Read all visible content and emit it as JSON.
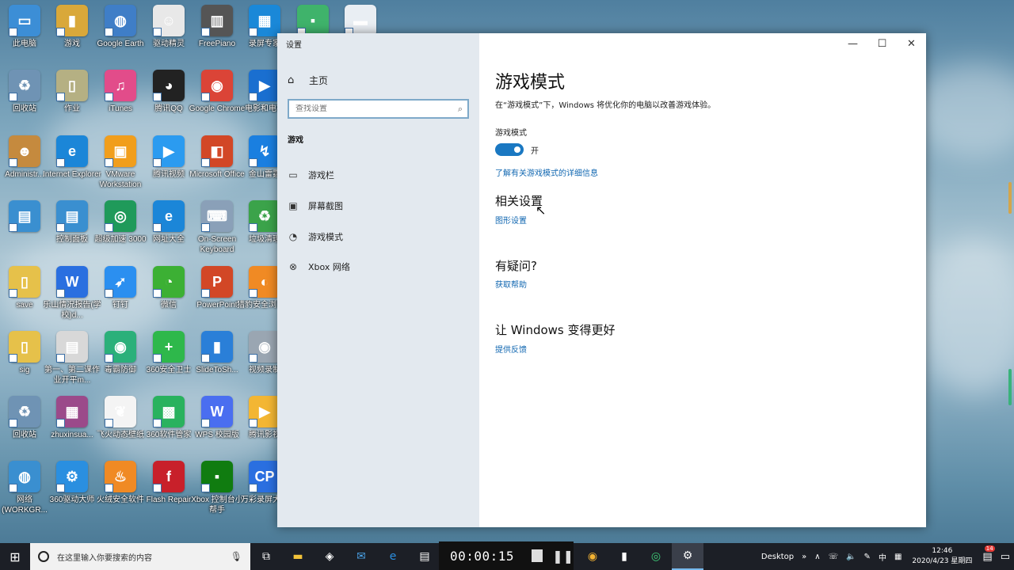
{
  "desktop": {
    "icons": [
      {
        "label": "此电脑",
        "color": "#3c8ed6",
        "glyph": "▭"
      },
      {
        "label": "游戏",
        "color": "#d9a83a",
        "glyph": "▮"
      },
      {
        "label": "Google Earth",
        "color": "#3f7ec7",
        "glyph": "◍"
      },
      {
        "label": "驱动精灵",
        "color": "#e8e8e8",
        "glyph": "☺"
      },
      {
        "label": "FreePiano",
        "color": "#555555",
        "glyph": "▥"
      },
      {
        "label": "录屏专家",
        "color": "#1a88d8",
        "glyph": "▦"
      },
      {
        "label": "",
        "color": "#3fb36b",
        "glyph": "▪"
      },
      {
        "label": "",
        "color": "#e9eef3",
        "glyph": "▬"
      },
      {
        "label": "回收站",
        "color": "#6f93b4",
        "glyph": "♻"
      },
      {
        "label": "作业",
        "color": "#b5b083",
        "glyph": "▯"
      },
      {
        "label": "iTunes",
        "color": "#e24c8a",
        "glyph": "♫"
      },
      {
        "label": "腾讯QQ",
        "color": "#222222",
        "glyph": "◕"
      },
      {
        "label": "Google Chrome",
        "color": "#db4437",
        "glyph": "◉"
      },
      {
        "label": "电影和电视",
        "color": "#1a6fd0",
        "glyph": "▶"
      },
      {
        "label": "Administr...",
        "color": "#c58a3e",
        "glyph": "☻"
      },
      {
        "label": "Internet Explorer",
        "color": "#1b86d8",
        "glyph": "e"
      },
      {
        "label": "VMware Workstation",
        "color": "#f19e1c",
        "glyph": "▣"
      },
      {
        "label": "腾讯视频",
        "color": "#2b9bf0",
        "glyph": "▶"
      },
      {
        "label": "Microsoft Office",
        "color": "#d24726",
        "glyph": "◧"
      },
      {
        "label": "金山雷霆",
        "color": "#1a7fe0",
        "glyph": "↯"
      },
      {
        "label": "",
        "color": "#3a8fd0",
        "glyph": "▤"
      },
      {
        "label": "控制面板",
        "color": "#3a8fd0",
        "glyph": "▤"
      },
      {
        "label": "超级加速 3000",
        "color": "#1f9a5a",
        "glyph": "◎"
      },
      {
        "label": "网址大全",
        "color": "#1b86d8",
        "glyph": "e"
      },
      {
        "label": "On-Screen Keyboard",
        "color": "#8aa0b8",
        "glyph": "⌨"
      },
      {
        "label": "垃圾清理",
        "color": "#3ba34a",
        "glyph": "♻"
      },
      {
        "label": "save",
        "color": "#e6c14a",
        "glyph": "▯"
      },
      {
        "label": "乐山情况报告(学校)d...",
        "color": "#2a6fe0",
        "glyph": "W"
      },
      {
        "label": "钉钉",
        "color": "#2b8ff0",
        "glyph": "➶"
      },
      {
        "label": "微信",
        "color": "#3cb034",
        "glyph": "◔"
      },
      {
        "label": "PowerPoint",
        "color": "#d24726",
        "glyph": "P"
      },
      {
        "label": "猎豹安全浏览器",
        "color": "#f08a24",
        "glyph": "◐"
      },
      {
        "label": "sig",
        "color": "#e6c14a",
        "glyph": "▯"
      },
      {
        "label": "第一、第二课作业开平m...",
        "color": "#d8d8d8",
        "glyph": "▤"
      },
      {
        "label": "毒霸防御",
        "color": "#2bb07a",
        "glyph": "◉"
      },
      {
        "label": "360安全卫士",
        "color": "#2eb84b",
        "glyph": "+"
      },
      {
        "label": "SlideToSh...",
        "color": "#2a7fd8",
        "glyph": "▮"
      },
      {
        "label": "视频录制",
        "color": "#9aa6b2",
        "glyph": "◉"
      },
      {
        "label": "回收站",
        "color": "#6f93b4",
        "glyph": "♻"
      },
      {
        "label": "zhuxinsua...",
        "color": "#9b4a8a",
        "glyph": "▦"
      },
      {
        "label": "飞火动态壁纸",
        "color": "#f4f4f4",
        "glyph": "❦"
      },
      {
        "label": "360软件管家",
        "color": "#29b25e",
        "glyph": "▩"
      },
      {
        "label": "WPS 校园版",
        "color": "#4a6ef0",
        "glyph": "W"
      },
      {
        "label": "腾讯影视",
        "color": "#f3b633",
        "glyph": "▶"
      },
      {
        "label": "网络 (WORKGR...",
        "color": "#3a8fd0",
        "glyph": "◍"
      },
      {
        "label": "360驱动大师",
        "color": "#2a8fe0",
        "glyph": "⚙"
      },
      {
        "label": "火绒安全软件",
        "color": "#f08a24",
        "glyph": "♨"
      },
      {
        "label": "Flash Repair",
        "color": "#c8202a",
        "glyph": "f"
      },
      {
        "label": "Xbox 控制台小帮手",
        "color": "#107c10",
        "glyph": "▪"
      },
      {
        "label": "万彩录屏大师",
        "color": "#2a6fe0",
        "glyph": "CP"
      }
    ]
  },
  "window": {
    "title": "设置",
    "controls": {
      "minimize": "—",
      "maximize": "☐",
      "close": "✕"
    },
    "sidebar": {
      "home_label": "主页",
      "search_placeholder": "查找设置",
      "section_title": "游戏",
      "items": [
        {
          "label": "游戏栏",
          "icon": "▭"
        },
        {
          "label": "屏幕截图",
          "icon": "▣"
        },
        {
          "label": "游戏模式",
          "icon": "◔"
        },
        {
          "label": "Xbox 网络",
          "icon": "⊗"
        }
      ]
    },
    "main": {
      "title": "游戏模式",
      "description": "在“游戏模式”下，Windows 将优化你的电脑以改善游戏体验。",
      "toggle_label": "游戏模式",
      "toggle_state": "开",
      "learn_more": "了解有关游戏模式的详细信息",
      "related_title": "相关设置",
      "related_link": "图形设置",
      "question_title": "有疑问?",
      "help_link": "获取帮助",
      "improve_title": "让 Windows 变得更好",
      "feedback_link": "提供反馈"
    }
  },
  "taskbar": {
    "search_placeholder": "在这里输入你要搜索的内容",
    "recording_time": "00:00:15",
    "tray_desktop": "Desktop",
    "tray_ime": "中",
    "clock_time": "12:46",
    "clock_date": "2020/4/23 星期四",
    "notification_count": "14"
  }
}
